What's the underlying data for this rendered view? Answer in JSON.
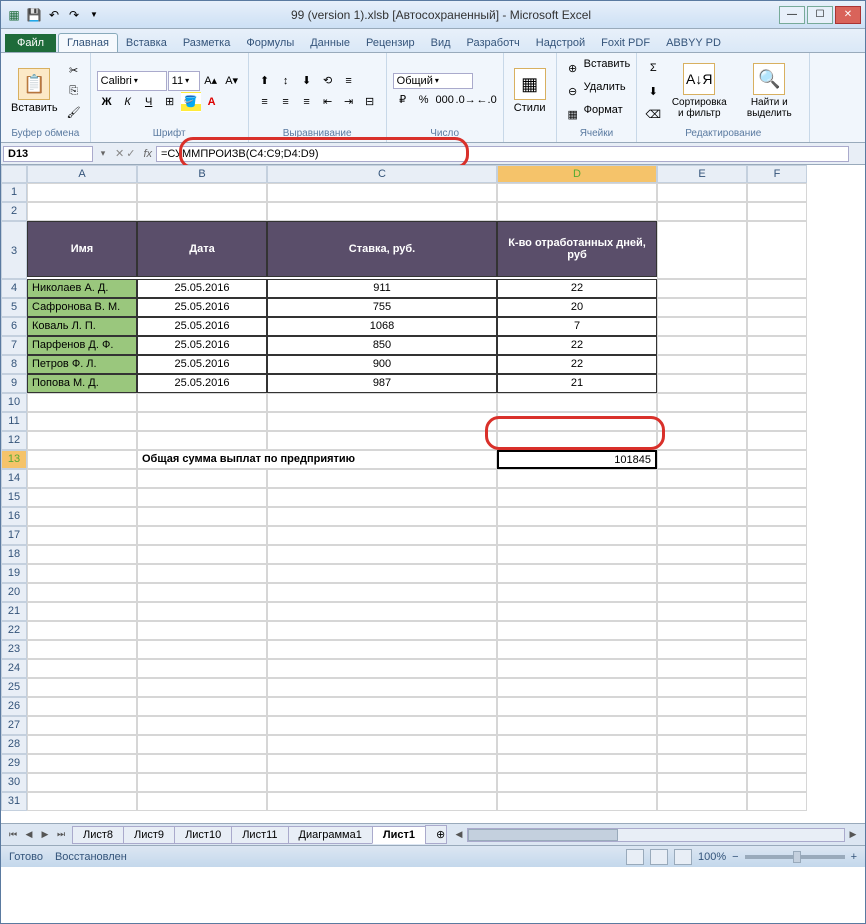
{
  "window": {
    "title": "99 (version 1).xlsb [Автосохраненный] - Microsoft Excel"
  },
  "ribbon": {
    "file": "Файл",
    "tabs": [
      "Главная",
      "Вставка",
      "Разметка",
      "Формулы",
      "Данные",
      "Рецензир",
      "Вид",
      "Разработч",
      "Надстрой",
      "Foxit PDF",
      "ABBYY PD"
    ],
    "active_tab": 0,
    "groups": {
      "clipboard": "Буфер обмена",
      "font": "Шрифт",
      "alignment": "Выравнивание",
      "number": "Число",
      "cells": "Ячейки",
      "editing": "Редактирование"
    },
    "paste": "Вставить",
    "font_name": "Calibri",
    "font_size": "11",
    "number_format": "Общий",
    "styles": "Стили",
    "insert": "Вставить",
    "delete": "Удалить",
    "format": "Формат",
    "sort": "Сортировка и фильтр",
    "find": "Найти и выделить"
  },
  "namebox": "D13",
  "formula": "=СУММПРОИЗВ(C4:C9;D4:D9)",
  "columns": [
    "A",
    "B",
    "C",
    "D",
    "E",
    "F"
  ],
  "headers": {
    "name": "Имя",
    "date": "Дата",
    "rate": "Ставка, руб.",
    "days": "К-во отработанных дней, руб"
  },
  "rows": [
    {
      "name": "Николаев А. Д.",
      "date": "25.05.2016",
      "rate": "911",
      "days": "22"
    },
    {
      "name": "Сафронова В. М.",
      "date": "25.05.2016",
      "rate": "755",
      "days": "20"
    },
    {
      "name": "Коваль Л. П.",
      "date": "25.05.2016",
      "rate": "1068",
      "days": "7"
    },
    {
      "name": "Парфенов Д. Ф.",
      "date": "25.05.2016",
      "rate": "850",
      "days": "22"
    },
    {
      "name": "Петров Ф. Л.",
      "date": "25.05.2016",
      "rate": "900",
      "days": "22"
    },
    {
      "name": "Попова М. Д.",
      "date": "25.05.2016",
      "rate": "987",
      "days": "21"
    }
  ],
  "total_label": "Общая сумма выплат по предприятию",
  "total_value": "101845",
  "sheet_tabs": [
    "Лист8",
    "Лист9",
    "Лист10",
    "Лист11",
    "Диаграмма1",
    "Лист1"
  ],
  "active_sheet": 5,
  "status": {
    "ready": "Готово",
    "recovered": "Восстановлен",
    "zoom": "100%"
  },
  "chart_data": {
    "type": "table",
    "title": "Общая сумма выплат по предприятию",
    "columns": [
      "Имя",
      "Дата",
      "Ставка, руб.",
      "К-во отработанных дней, руб"
    ],
    "data": [
      [
        "Николаев А. Д.",
        "25.05.2016",
        911,
        22
      ],
      [
        "Сафронова В. М.",
        "25.05.2016",
        755,
        20
      ],
      [
        "Коваль Л. П.",
        "25.05.2016",
        1068,
        7
      ],
      [
        "Парфенов Д. Ф.",
        "25.05.2016",
        850,
        22
      ],
      [
        "Петров Ф. Л.",
        "25.05.2016",
        900,
        22
      ],
      [
        "Попова М. Д.",
        "25.05.2016",
        987,
        21
      ]
    ],
    "formula": "=СУММПРОИЗВ(C4:C9;D4:D9)",
    "result": 101845
  }
}
